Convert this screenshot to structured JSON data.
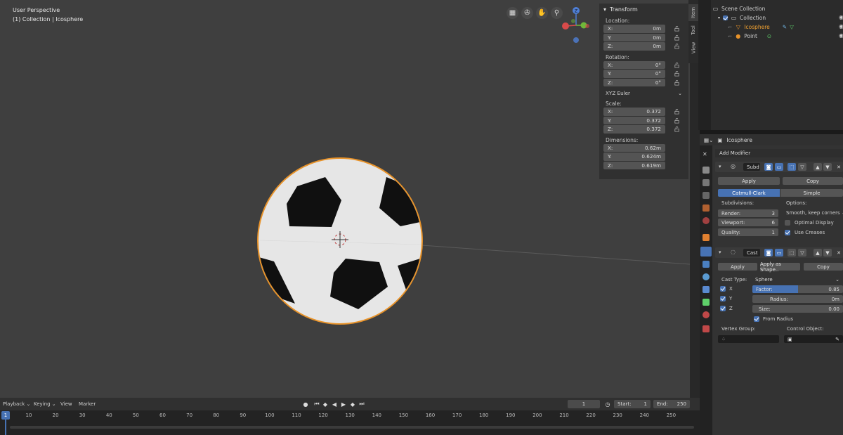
{
  "viewport": {
    "perspective": "User Perspective",
    "collection_info": "(1) Collection | Icosphere",
    "gizmo": {
      "z_label": "Z"
    }
  },
  "npanel": {
    "title": "Transform",
    "location_label": "Location:",
    "location": [
      {
        "axis": "X:",
        "value": "0m"
      },
      {
        "axis": "Y:",
        "value": "0m"
      },
      {
        "axis": "Z:",
        "value": "0m"
      }
    ],
    "rotation_label": "Rotation:",
    "rotation": [
      {
        "axis": "X:",
        "value": "0°"
      },
      {
        "axis": "Y:",
        "value": "0°"
      },
      {
        "axis": "Z:",
        "value": "0°"
      }
    ],
    "rotation_mode": "XYZ Euler",
    "scale_label": "Scale:",
    "scale": [
      {
        "axis": "X:",
        "value": "0.372"
      },
      {
        "axis": "Y:",
        "value": "0.372"
      },
      {
        "axis": "Z:",
        "value": "0.372"
      }
    ],
    "dimensions_label": "Dimensions:",
    "dimensions": [
      {
        "axis": "X:",
        "value": "0.62m"
      },
      {
        "axis": "Y:",
        "value": "0.624m"
      },
      {
        "axis": "Z:",
        "value": "0.619m"
      }
    ]
  },
  "sidebar_tabs": [
    "Item",
    "Tool",
    "View"
  ],
  "outliner": {
    "root": "Scene Collection",
    "collection": "Collection",
    "items": [
      {
        "name": "Icosphere",
        "selected": true
      },
      {
        "name": "Point",
        "selected": false
      }
    ]
  },
  "properties": {
    "object_name": "Icosphere",
    "add_modifier": "Add Modifier",
    "subsurf": {
      "name": "Subd",
      "apply": "Apply",
      "copy": "Copy",
      "type_options": [
        "Catmull-Clark",
        "Simple"
      ],
      "subdivisions_label": "Subdivisions:",
      "options_label": "Options:",
      "render_label": "Render:",
      "render_value": "3",
      "viewport_label": "Viewport:",
      "viewport_value": "6",
      "quality_label": "Quality:",
      "quality_value": "1",
      "uv_smooth": "Smooth, keep corners",
      "optimal_display": "Optimal Display",
      "use_creases": "Use Creases"
    },
    "cast": {
      "name": "Cast",
      "apply": "Apply",
      "apply_shape": "Apply as Shape..",
      "copy": "Copy",
      "cast_type_label": "Cast Type:",
      "cast_type": "Sphere",
      "axes": [
        "X",
        "Y",
        "Z"
      ],
      "factor_label": "Factor:",
      "factor_value": "0.85",
      "factor_fill": 0.5,
      "radius_label": "Radius:",
      "radius_value": "0m",
      "size_label": "Size:",
      "size_value": "0.00",
      "from_radius": "From Radius",
      "vertex_group_label": "Vertex Group:",
      "control_object_label": "Control Object:"
    }
  },
  "timeline": {
    "menu": [
      "Playback",
      "Keying",
      "View",
      "Marker"
    ],
    "current_frame": "1",
    "start_label": "Start:",
    "start_value": "1",
    "end_label": "End:",
    "end_value": "250",
    "ticks": [
      "1",
      "10",
      "20",
      "30",
      "40",
      "50",
      "60",
      "70",
      "80",
      "90",
      "100",
      "110",
      "120",
      "130",
      "140",
      "150",
      "160",
      "170",
      "180",
      "190",
      "200",
      "210",
      "220",
      "230",
      "240",
      "250"
    ]
  },
  "colors": {
    "accent": "#4772b3",
    "selection_outline": "#e8932a",
    "ball_white": "#e6e6e6",
    "ball_black": "#101010"
  }
}
